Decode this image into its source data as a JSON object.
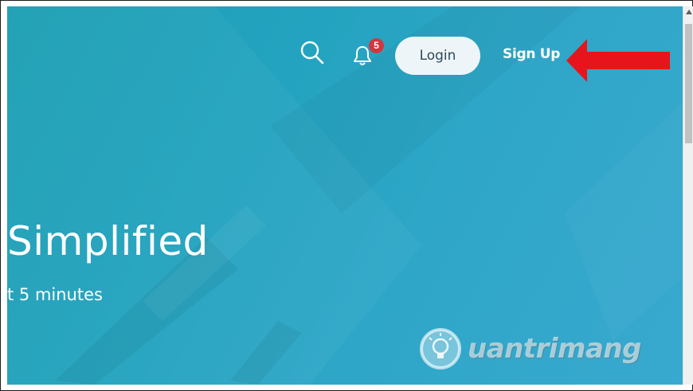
{
  "header": {
    "search_icon": "search-icon",
    "bell_icon": "bell-icon",
    "notification_count": "5",
    "login_label": "Login",
    "signup_label": "Sign Up"
  },
  "hero": {
    "title": "Simplified",
    "subtitle": "t 5 minutes"
  },
  "watermark": {
    "text": "uantrimang",
    "icon": "lightbulb-icon"
  },
  "colors": {
    "hero_start": "#1d9fb3",
    "hero_end": "#38a9cf",
    "login_bg": "#eef5f8",
    "badge": "#d2373f",
    "arrow": "#e8141c"
  }
}
